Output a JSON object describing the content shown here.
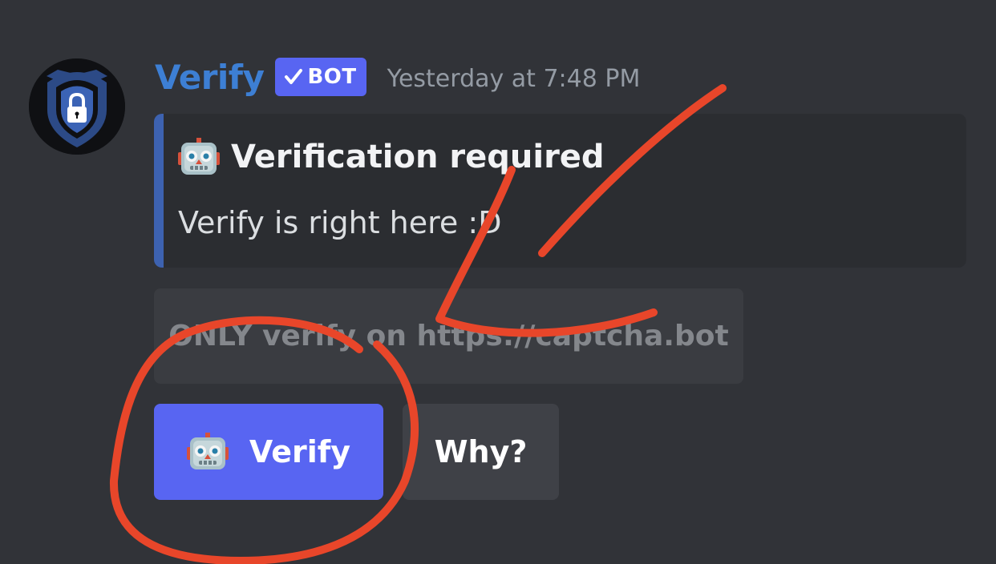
{
  "message": {
    "author": "Verify",
    "badge": "BOT",
    "timestamp": "Yesterday at 7:48 PM",
    "avatar_icon": "shield-lock-icon"
  },
  "embed": {
    "icon": "robot-face-icon",
    "title": "Verification required",
    "description": "Verify is right here :D",
    "accent_color": "#3d62b0"
  },
  "buttons": {
    "warning_label": "ONLY verify on https://captcha.bot",
    "verify_icon": "robot-face-icon",
    "verify_label": "Verify",
    "why_label": "Why?"
  },
  "colors": {
    "background": "#313338",
    "embed_background": "#2b2d31",
    "username": "#3d7fd4",
    "blurple": "#5865f2",
    "secondary_button": "#3f4147",
    "annotation": "#e8462a"
  }
}
